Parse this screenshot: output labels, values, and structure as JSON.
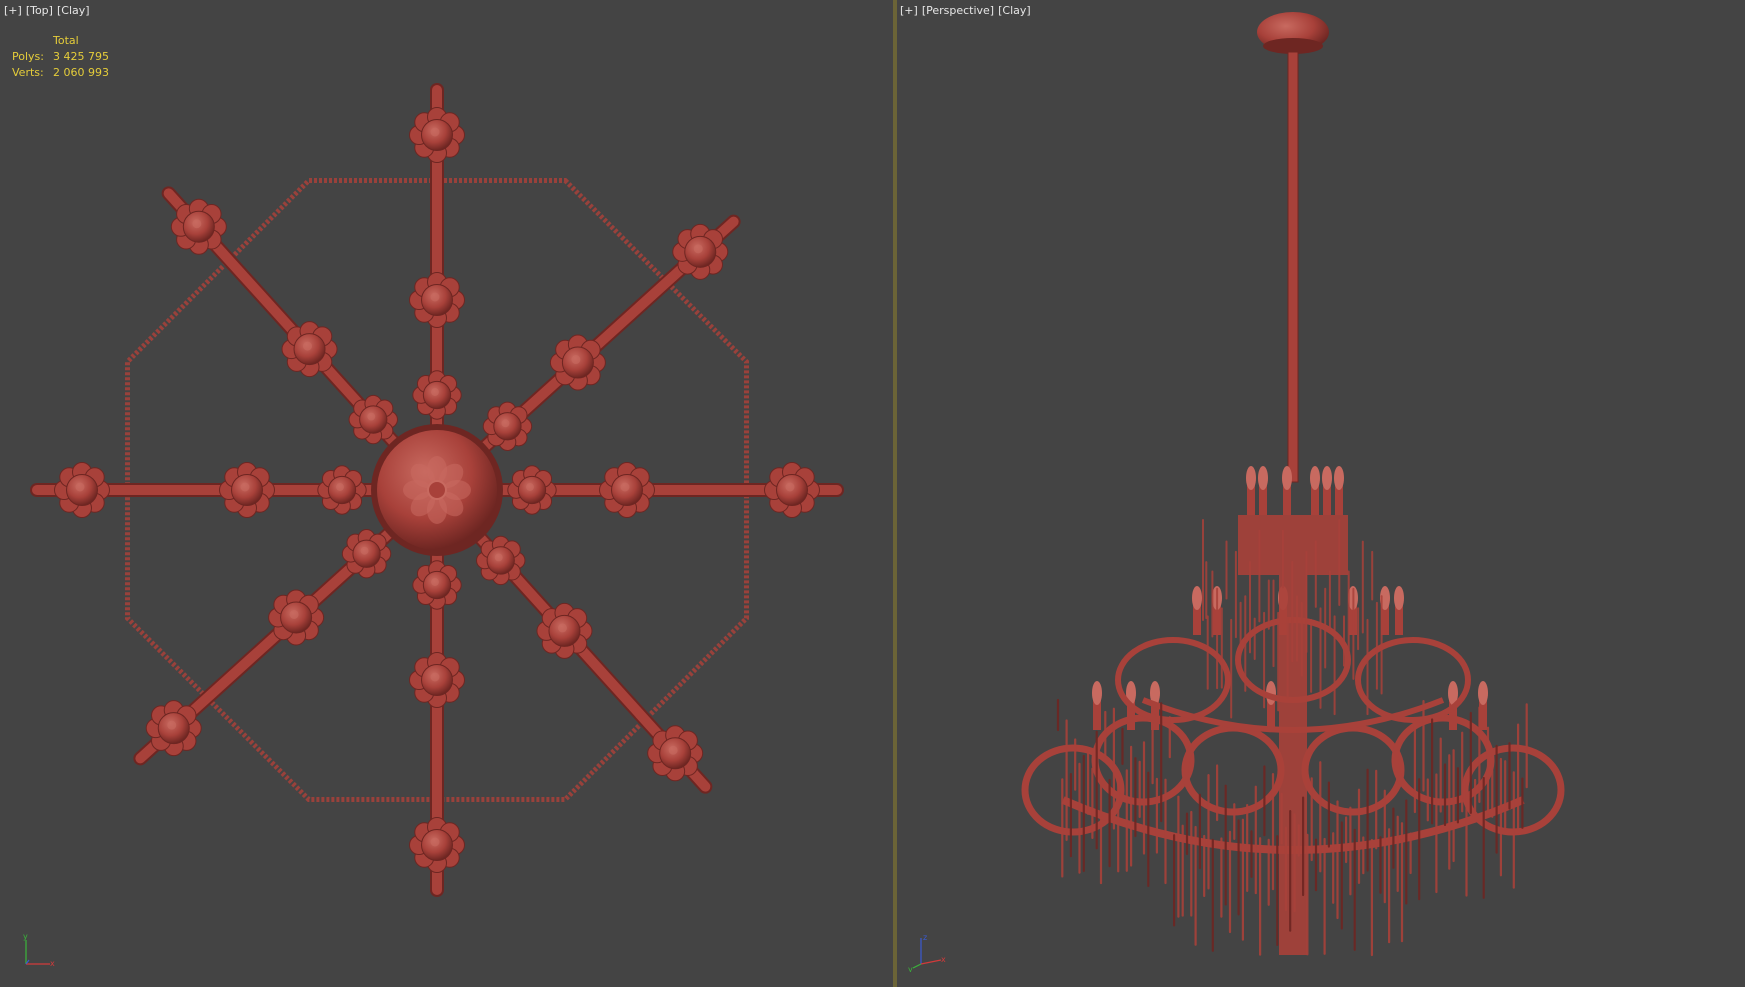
{
  "viewports": {
    "left": {
      "label_parts": [
        "[+]",
        "[Top]",
        "[Clay]"
      ],
      "stats": {
        "header": "Total",
        "polys_label": "Polys:",
        "polys_value": "3 425 795",
        "verts_label": "Verts:",
        "verts_value": "2 060 993"
      }
    },
    "right": {
      "label_parts": [
        "[+]",
        "[Perspective]",
        "[Clay]"
      ]
    }
  },
  "axis_gizmo": {
    "axes": [
      "X",
      "Y",
      "Z"
    ],
    "colors": {
      "x": "#d23a3a",
      "y": "#3ab53a",
      "z": "#3a5ad2"
    }
  },
  "colors": {
    "background": "#444444",
    "divider": "#6b6437",
    "clay": "#a8413a",
    "clay_dark": "#6e2622",
    "clay_light": "#c86a60",
    "stats_text": "#e5cd3a",
    "label_text": "#e6e6e6"
  }
}
